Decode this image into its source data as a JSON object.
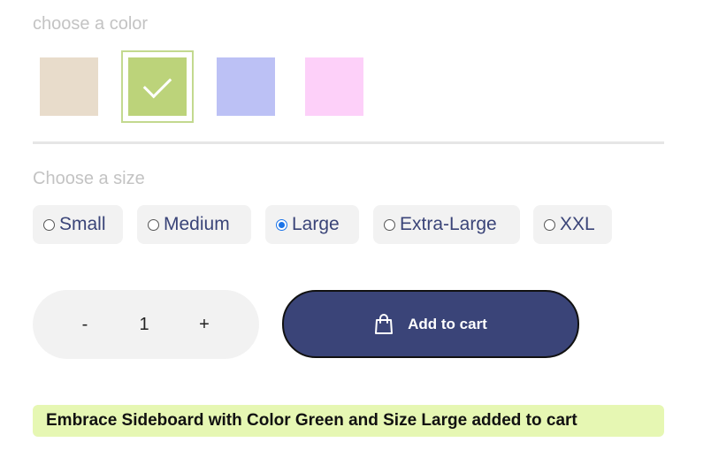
{
  "color_section": {
    "label": "choose a color",
    "swatches": [
      {
        "name": "beige",
        "hex": "#e8dccb",
        "selected": false
      },
      {
        "name": "green",
        "hex": "#bcd37a",
        "selected": true
      },
      {
        "name": "periwinkle",
        "hex": "#bcc1f5",
        "selected": false
      },
      {
        "name": "pink",
        "hex": "#fdd0f9",
        "selected": false
      }
    ]
  },
  "size_section": {
    "label": "Choose a size",
    "options": [
      {
        "label": "Small",
        "selected": false
      },
      {
        "label": "Medium",
        "selected": false
      },
      {
        "label": "Large",
        "selected": true
      },
      {
        "label": "Extra-Large",
        "selected": false
      },
      {
        "label": "XXL",
        "selected": false
      }
    ]
  },
  "quantity": {
    "minus_label": "-",
    "value": "1",
    "plus_label": "+"
  },
  "cart_button": {
    "label": "Add to cart",
    "icon": "shopping-bag-icon",
    "color": "#3a4478"
  },
  "notification": {
    "text": "Embrace Sideboard with Color Green and Size Large added to cart",
    "background": "#e6f7b3"
  }
}
